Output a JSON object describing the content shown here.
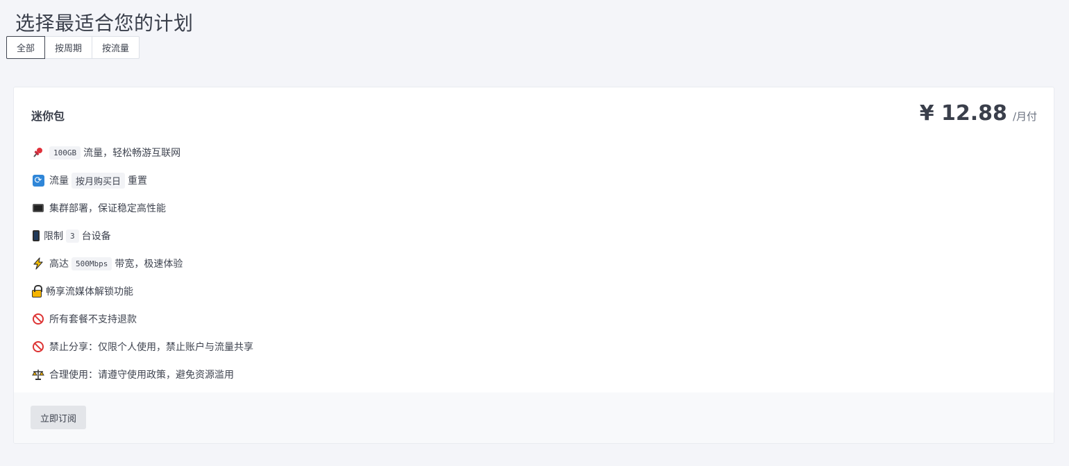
{
  "page": {
    "title": "选择最适合您的计划"
  },
  "tabs": [
    {
      "label": "全部",
      "active": true
    },
    {
      "label": "按周期",
      "active": false
    },
    {
      "label": "按流量",
      "active": false
    }
  ],
  "plan": {
    "name": "迷你包",
    "price": "¥ 12.88",
    "price_unit": "/月付",
    "features": [
      {
        "icon": "pin-icon",
        "glyph": "📌",
        "parts": [
          {
            "code": "100GB"
          },
          {
            "text": "流量，轻松畅游互联网"
          }
        ]
      },
      {
        "icon": "sync-icon",
        "glyph": "🔄",
        "parts": [
          {
            "text": "流量"
          },
          {
            "tag": "按月购买日"
          },
          {
            "text": "重置"
          }
        ]
      },
      {
        "icon": "monitor-icon",
        "glyph": "🖥",
        "parts": [
          {
            "text": "集群部署，保证稳定高性能"
          }
        ]
      },
      {
        "icon": "phone-icon",
        "glyph": "📱",
        "parts": [
          {
            "text": "限制"
          },
          {
            "tag": "3"
          },
          {
            "text": "台设备"
          }
        ]
      },
      {
        "icon": "lightning-icon",
        "glyph": "⚡",
        "parts": [
          {
            "text": "高达"
          },
          {
            "code": "500Mbps"
          },
          {
            "text": "带宽，极速体验"
          }
        ]
      },
      {
        "icon": "lock-icon",
        "glyph": "🔒",
        "parts": [
          {
            "text": "畅享流媒体解锁功能"
          }
        ]
      },
      {
        "icon": "no-entry-icon",
        "glyph": "🚫",
        "parts": [
          {
            "text": "所有套餐不支持退款"
          }
        ]
      },
      {
        "icon": "no-entry-icon",
        "glyph": "🚫",
        "parts": [
          {
            "text": "禁止分享：仅限个人使用，禁止账户与流量共享"
          }
        ]
      },
      {
        "icon": "scales-icon",
        "glyph": "⚖",
        "parts": [
          {
            "text": "合理使用：请遵守使用政策，避免资源滥用"
          }
        ]
      }
    ],
    "subscribe_label": "立即订阅"
  }
}
